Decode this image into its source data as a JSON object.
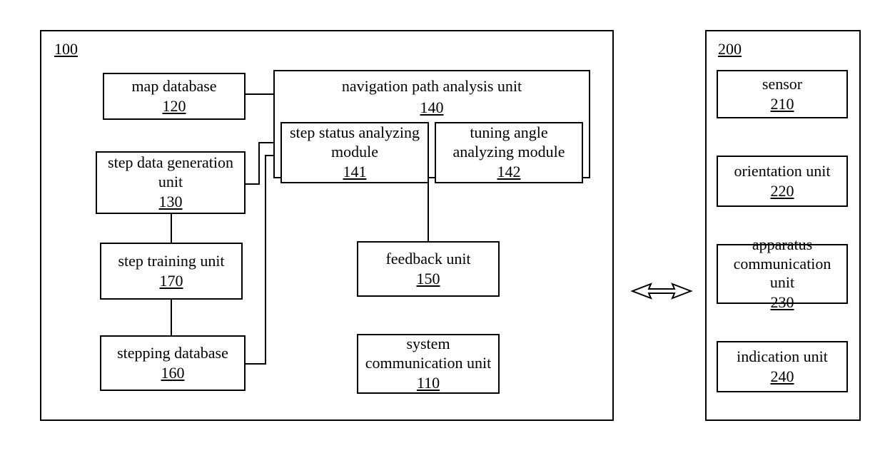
{
  "system100": {
    "ref": "100",
    "mapdb": {
      "title": "map database",
      "num": "120"
    },
    "stepgen": {
      "title": "step data generation unit",
      "num": "130"
    },
    "steptraining": {
      "title": "step training unit",
      "num": "170"
    },
    "steppingdb": {
      "title": "stepping database",
      "num": "160"
    },
    "nav": {
      "title": "navigation path analysis unit",
      "num": "140"
    },
    "stepstatus": {
      "title": "step status analyzing module",
      "num": "141"
    },
    "tuningangle": {
      "title": "tuning angle analyzing module",
      "num": "142"
    },
    "feedback": {
      "title": "feedback unit",
      "num": "150"
    },
    "syscomm": {
      "title": "system communication unit",
      "num": "110"
    }
  },
  "apparatus200": {
    "ref": "200",
    "sensor": {
      "title": "sensor",
      "num": "210"
    },
    "orientation": {
      "title": "orientation unit",
      "num": "220"
    },
    "appcomm": {
      "title": "apparatus communication unit",
      "num": "230"
    },
    "indication": {
      "title": "indication unit",
      "num": "240"
    }
  }
}
